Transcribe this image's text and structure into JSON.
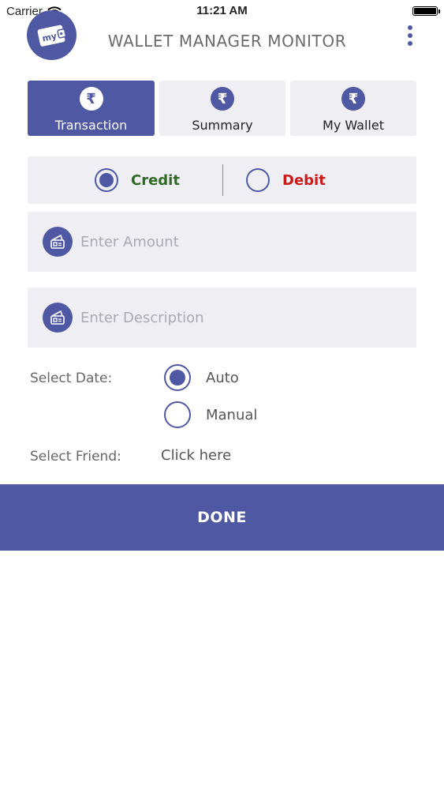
{
  "status_bar": {
    "carrier": "Carrier",
    "time": "11:21 AM",
    "wifi_icon": "wifi-icon",
    "battery_icon": "battery-icon",
    "battery_level": 1.0
  },
  "header": {
    "logo_text": "my",
    "title": "WALLET MANAGER MONITOR",
    "menu_icon": "more-vertical-icon"
  },
  "tabs": [
    {
      "label": "Transaction",
      "icon": "rupee-icon",
      "glyph": "₹",
      "selected": true
    },
    {
      "label": "Summary",
      "icon": "rupee-icon",
      "glyph": "₹",
      "selected": false
    },
    {
      "label": "My Wallet",
      "icon": "rupee-icon",
      "glyph": "₹",
      "selected": false
    }
  ],
  "transaction_type": {
    "options": [
      {
        "label": "Credit",
        "selected": true,
        "color": "#2e6a22"
      },
      {
        "label": "Debit",
        "selected": false,
        "color": "#cc1a1a"
      }
    ]
  },
  "form": {
    "amount": {
      "placeholder": "Enter Amount",
      "value": "",
      "icon": "wallet-card-icon"
    },
    "description": {
      "placeholder": "Enter Description",
      "value": "",
      "icon": "wallet-card-icon"
    },
    "date": {
      "label": "Select Date:",
      "options": [
        {
          "label": "Auto",
          "selected": true
        },
        {
          "label": "Manual",
          "selected": false
        }
      ]
    },
    "friend": {
      "label": "Select Friend:",
      "action": "Click here"
    }
  },
  "done_button": {
    "label": "DONE"
  },
  "colors": {
    "accent": "#4f58a2",
    "surface": "#efeef3",
    "credit": "#2e6a22",
    "debit": "#cc1a1a"
  }
}
